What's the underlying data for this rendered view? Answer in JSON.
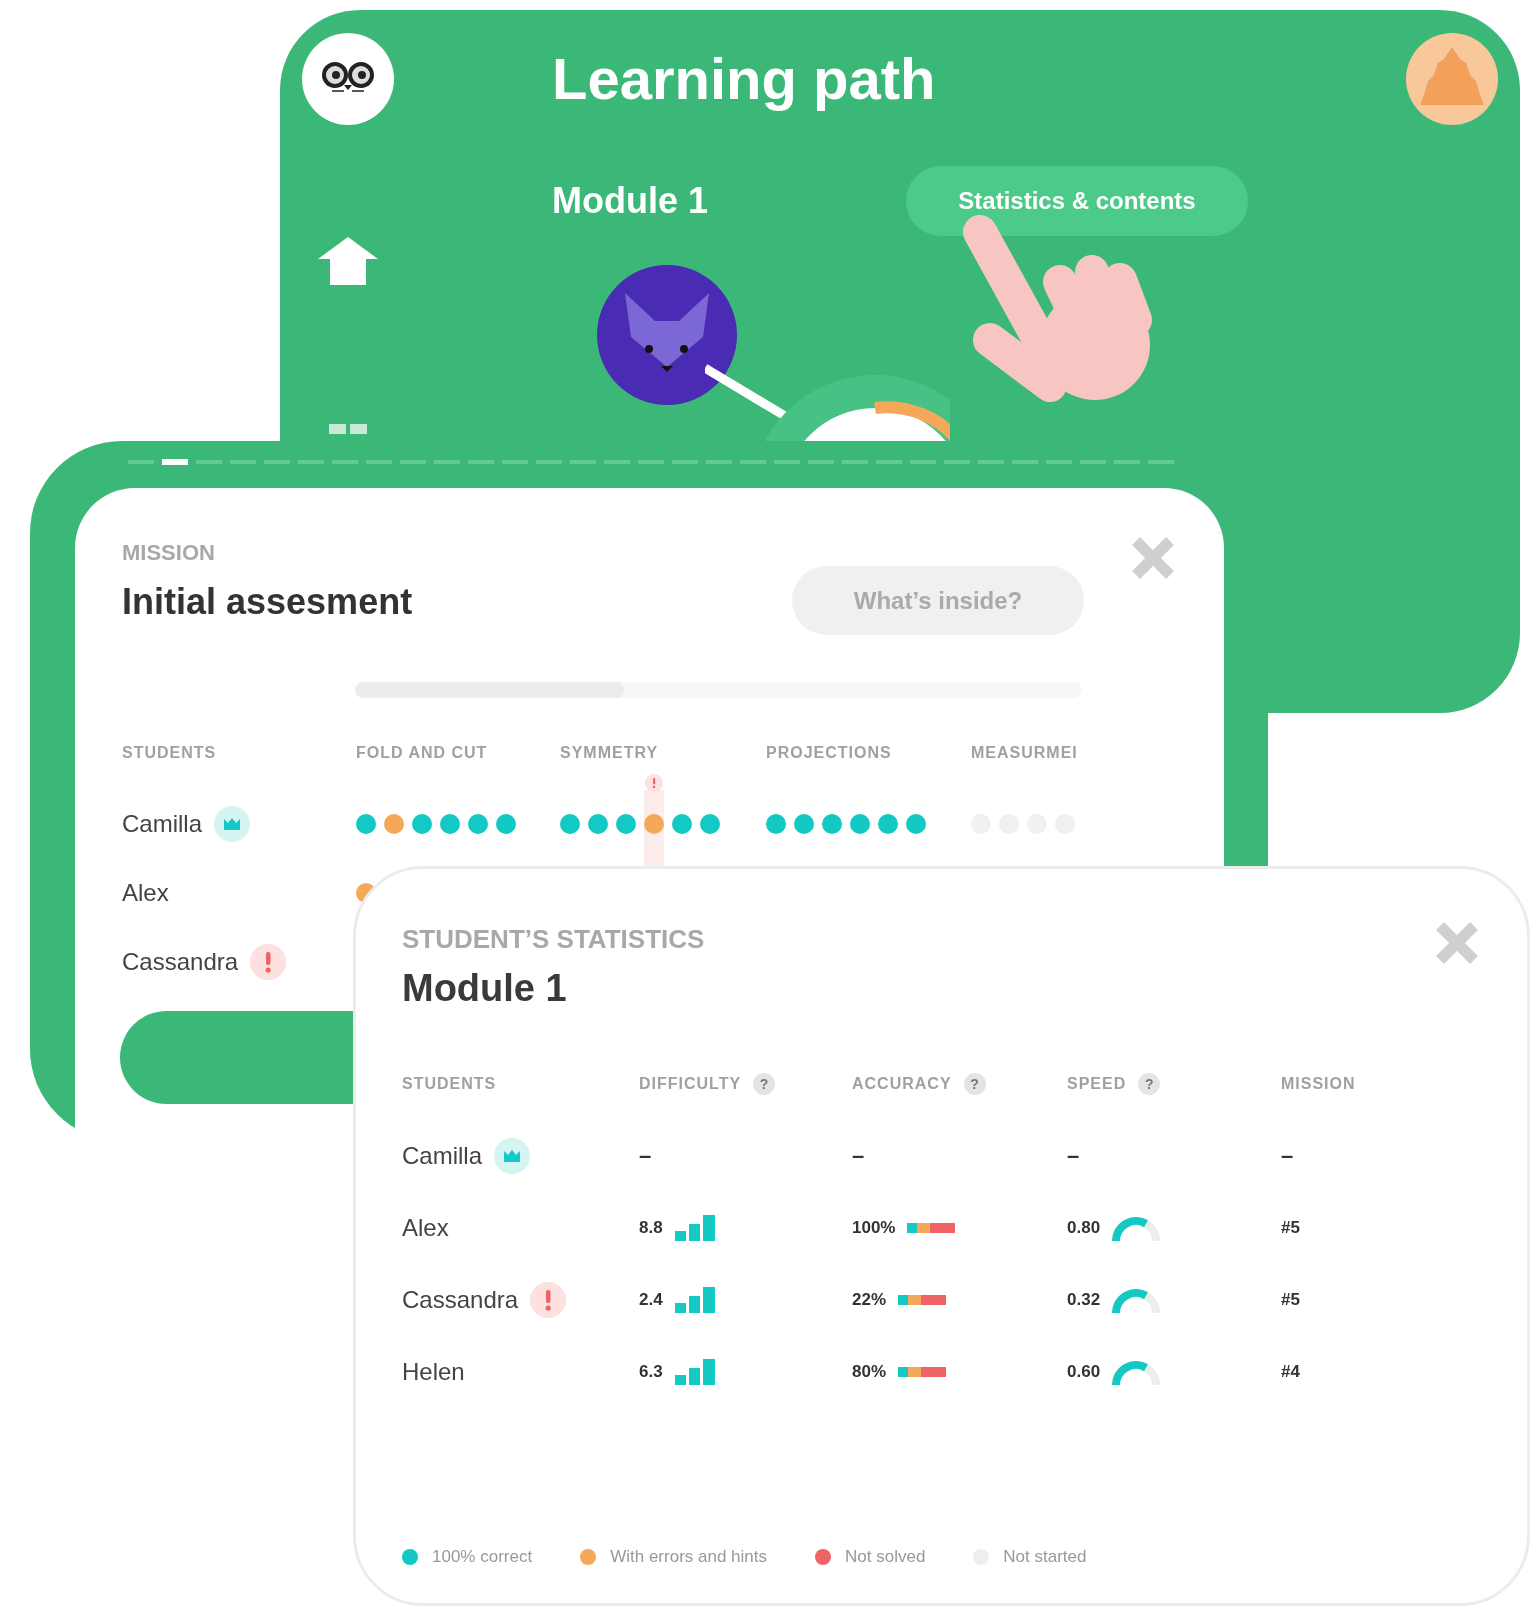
{
  "learning_path": {
    "title": "Learning path",
    "module": "Module 1",
    "button": "Statistics & contents"
  },
  "mission_panel": {
    "stepper": [
      {
        "selected": false
      },
      {
        "selected": true
      },
      {
        "selected": false
      },
      {
        "selected": false
      },
      {
        "selected": false
      },
      {
        "selected": false
      },
      {
        "selected": false
      },
      {
        "selected": false
      },
      {
        "selected": false
      },
      {
        "selected": false
      },
      {
        "selected": false
      },
      {
        "selected": false
      },
      {
        "selected": false
      },
      {
        "selected": false
      },
      {
        "selected": false
      },
      {
        "selected": false
      },
      {
        "selected": false
      },
      {
        "selected": false
      },
      {
        "selected": false
      },
      {
        "selected": false
      },
      {
        "selected": false
      },
      {
        "selected": false
      },
      {
        "selected": false
      },
      {
        "selected": false
      },
      {
        "selected": false
      },
      {
        "selected": false
      },
      {
        "selected": false
      },
      {
        "selected": false
      },
      {
        "selected": false
      },
      {
        "selected": false
      },
      {
        "selected": false
      }
    ],
    "label": "MISSION",
    "title": "Initial assesment",
    "button": "What’s inside?",
    "progress": {
      "level": 0.37
    },
    "columns": [
      "STUDENTS",
      "FOLD AND CUT",
      "SYMMETRY",
      "PROJECTIONS",
      "MEASURMEI"
    ],
    "students": [
      {
        "name": "Camilla",
        "badge": {
          "kind": "crown"
        },
        "results": [
          [
            {
              "kind": "correct"
            },
            {
              "kind": "errors"
            },
            {
              "kind": "correct"
            },
            {
              "kind": "correct"
            },
            {
              "kind": "correct"
            },
            {
              "kind": "correct"
            }
          ],
          [
            {
              "kind": "correct"
            },
            {
              "kind": "correct"
            },
            {
              "kind": "correct"
            },
            {
              "kind": "flagged"
            },
            {
              "kind": "correct"
            },
            {
              "kind": "correct"
            }
          ],
          [
            {
              "kind": "correct"
            },
            {
              "kind": "correct"
            },
            {
              "kind": "correct"
            },
            {
              "kind": "correct"
            },
            {
              "kind": "correct"
            },
            {
              "kind": "correct"
            }
          ],
          [
            {
              "kind": "not_started"
            },
            {
              "kind": "not_started"
            },
            {
              "kind": "not_started"
            },
            {
              "kind": "not_started"
            }
          ]
        ]
      },
      {
        "name": "Alex",
        "results": [
          [
            {
              "kind": "errors"
            }
          ]
        ]
      },
      {
        "name": "Cassandra",
        "badge": {
          "kind": "alert"
        }
      }
    ]
  },
  "stats_panel": {
    "label": "STUDENT’S STATISTICS",
    "title": "Module 1",
    "columns": [
      {
        "label": "STUDENTS"
      },
      {
        "label": "DIFFICULTY",
        "help": "?"
      },
      {
        "label": "ACCURACY",
        "help": "?"
      },
      {
        "label": "SPEED",
        "help": "?"
      },
      {
        "label": "MISSION"
      }
    ],
    "rows": [
      {
        "kind": "pending",
        "name": "Camilla",
        "badge": {
          "kind": "crown"
        },
        "difficulty": "–",
        "accuracy": "–",
        "speed": "–",
        "mission": "–"
      },
      {
        "kind": "scored",
        "name": "Alex",
        "difficulty": "8.8",
        "accuracy": "100%",
        "speed": "0.80",
        "mission": "#5"
      },
      {
        "kind": "scored",
        "name": "Cassandra",
        "badge": {
          "kind": "alert"
        },
        "difficulty": "2.4",
        "accuracy": "22%",
        "speed": "0.32",
        "mission": "#5"
      },
      {
        "kind": "scored",
        "name": "Helen",
        "difficulty": "6.3",
        "accuracy": "80%",
        "speed": "0.60",
        "mission": "#4"
      }
    ]
  },
  "legend": [
    {
      "label": "100% correct",
      "color": "#14c8c4"
    },
    {
      "label": "With errors and hints",
      "color": "#f5a85a"
    },
    {
      "label": "Not solved",
      "color": "#ee6464"
    },
    {
      "label": "Not started",
      "color": "#eeeeee"
    }
  ]
}
